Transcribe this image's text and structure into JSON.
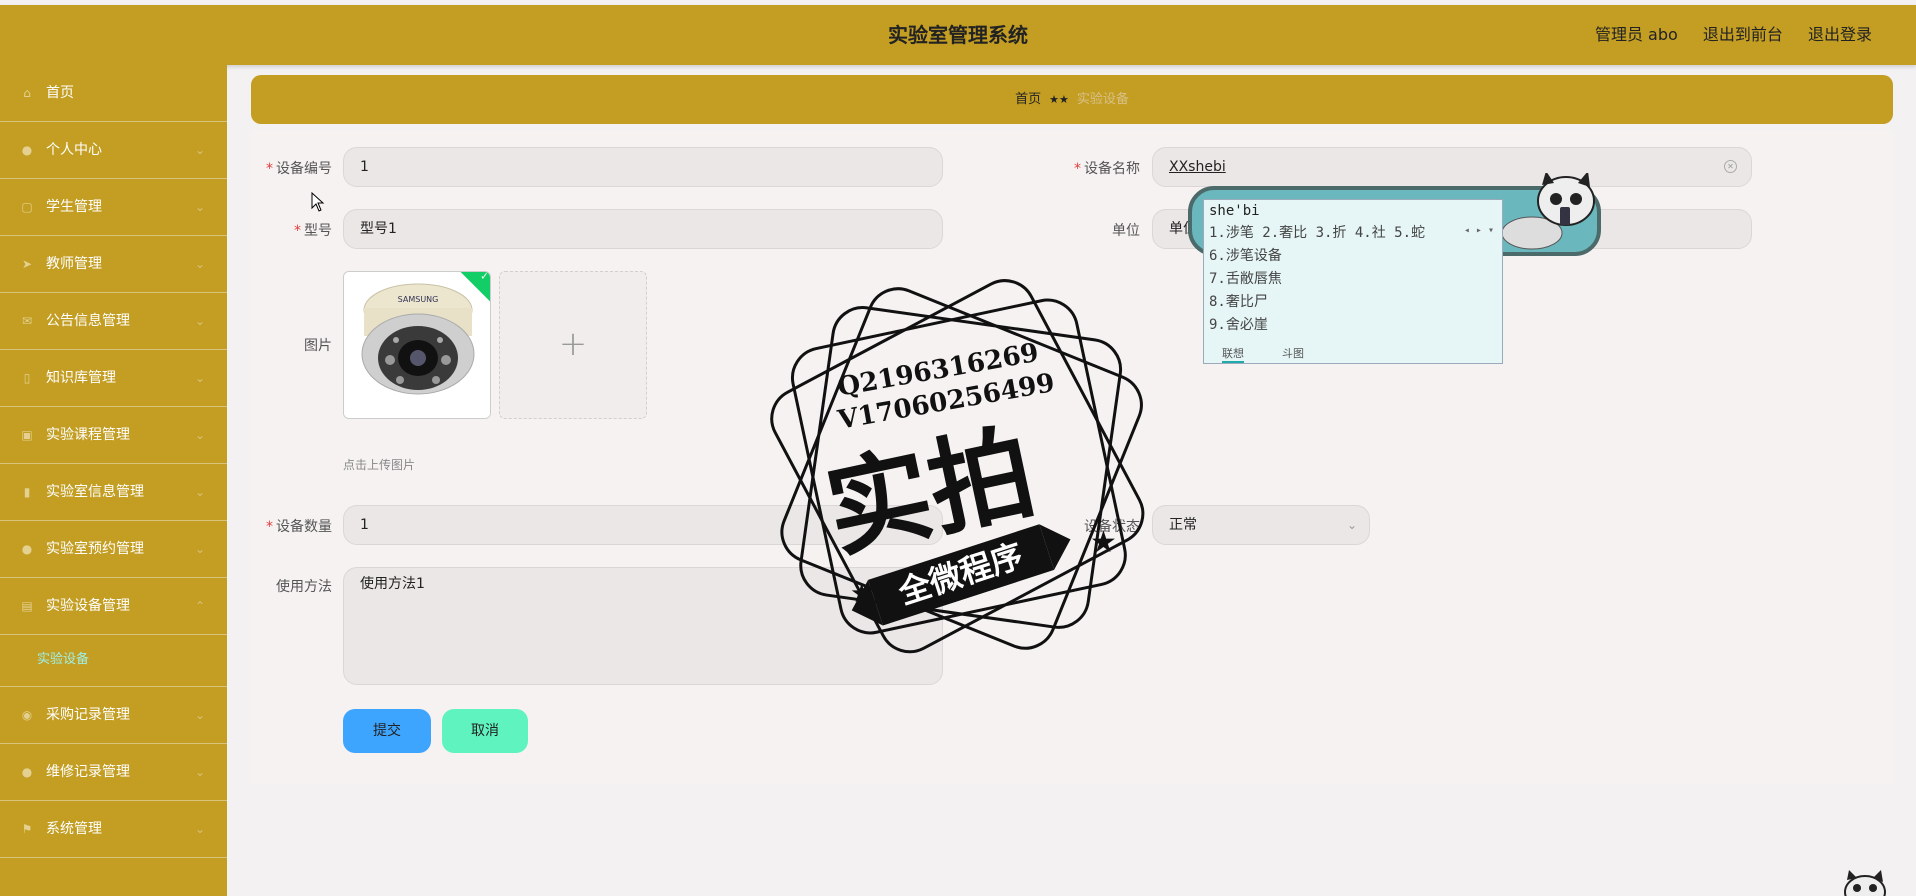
{
  "header": {
    "title": "实验室管理系统",
    "user": "管理员 abo",
    "front": "退出到前台",
    "logout": "退出登录"
  },
  "sidebar": {
    "items": [
      {
        "label": "首页",
        "icon": "home-icon"
      },
      {
        "label": "个人中心",
        "icon": "user-icon"
      },
      {
        "label": "学生管理",
        "icon": "student-icon"
      },
      {
        "label": "教师管理",
        "icon": "teacher-icon"
      },
      {
        "label": "公告信息管理",
        "icon": "mail-icon"
      },
      {
        "label": "知识库管理",
        "icon": "book-icon"
      },
      {
        "label": "实验课程管理",
        "icon": "course-icon"
      },
      {
        "label": "实验室信息管理",
        "icon": "chart-icon"
      },
      {
        "label": "实验室预约管理",
        "icon": "person-icon"
      },
      {
        "label": "实验设备管理",
        "icon": "device-icon"
      },
      {
        "label": "采购记录管理",
        "icon": "location-icon"
      },
      {
        "label": "维修记录管理",
        "icon": "person-icon"
      },
      {
        "label": "系统管理",
        "icon": "flag-icon"
      }
    ],
    "sub_active": "实验设备"
  },
  "breadcrumb": {
    "home": "首页",
    "sep": "★★",
    "current": "实验设备"
  },
  "form": {
    "device_no_label": "设备编号",
    "device_no_value": "1",
    "device_name_label": "设备名称",
    "device_name_value": "XXshebi",
    "model_label": "型号",
    "model_value": "型号1",
    "unit_label": "单位",
    "unit_value": "单位",
    "image_label": "图片",
    "upload_hint": "点击上传图片",
    "qty_label": "设备数量",
    "qty_value": "1",
    "status_label": "设备状态",
    "status_value": "正常",
    "usage_label": "使用方法",
    "usage_value": "使用方法1",
    "submit": "提交",
    "cancel": "取消",
    "camera_brand": "SAMSUNG"
  },
  "ime": {
    "pinyin": "she'bi",
    "row1": "1.涉笔 2.奢比 3.折 4.社 5.蛇",
    "c6": "6.涉笔设备",
    "c7": "7.舌敝唇焦",
    "c8": "8.奢比尸",
    "c9": "9.舍必崖",
    "tab1": "联想",
    "tab2": "斗图"
  },
  "watermark": {
    "line1": "Q2196316269",
    "line2": "V17060256499",
    "big": "实拍",
    "banner": "全微程序"
  }
}
